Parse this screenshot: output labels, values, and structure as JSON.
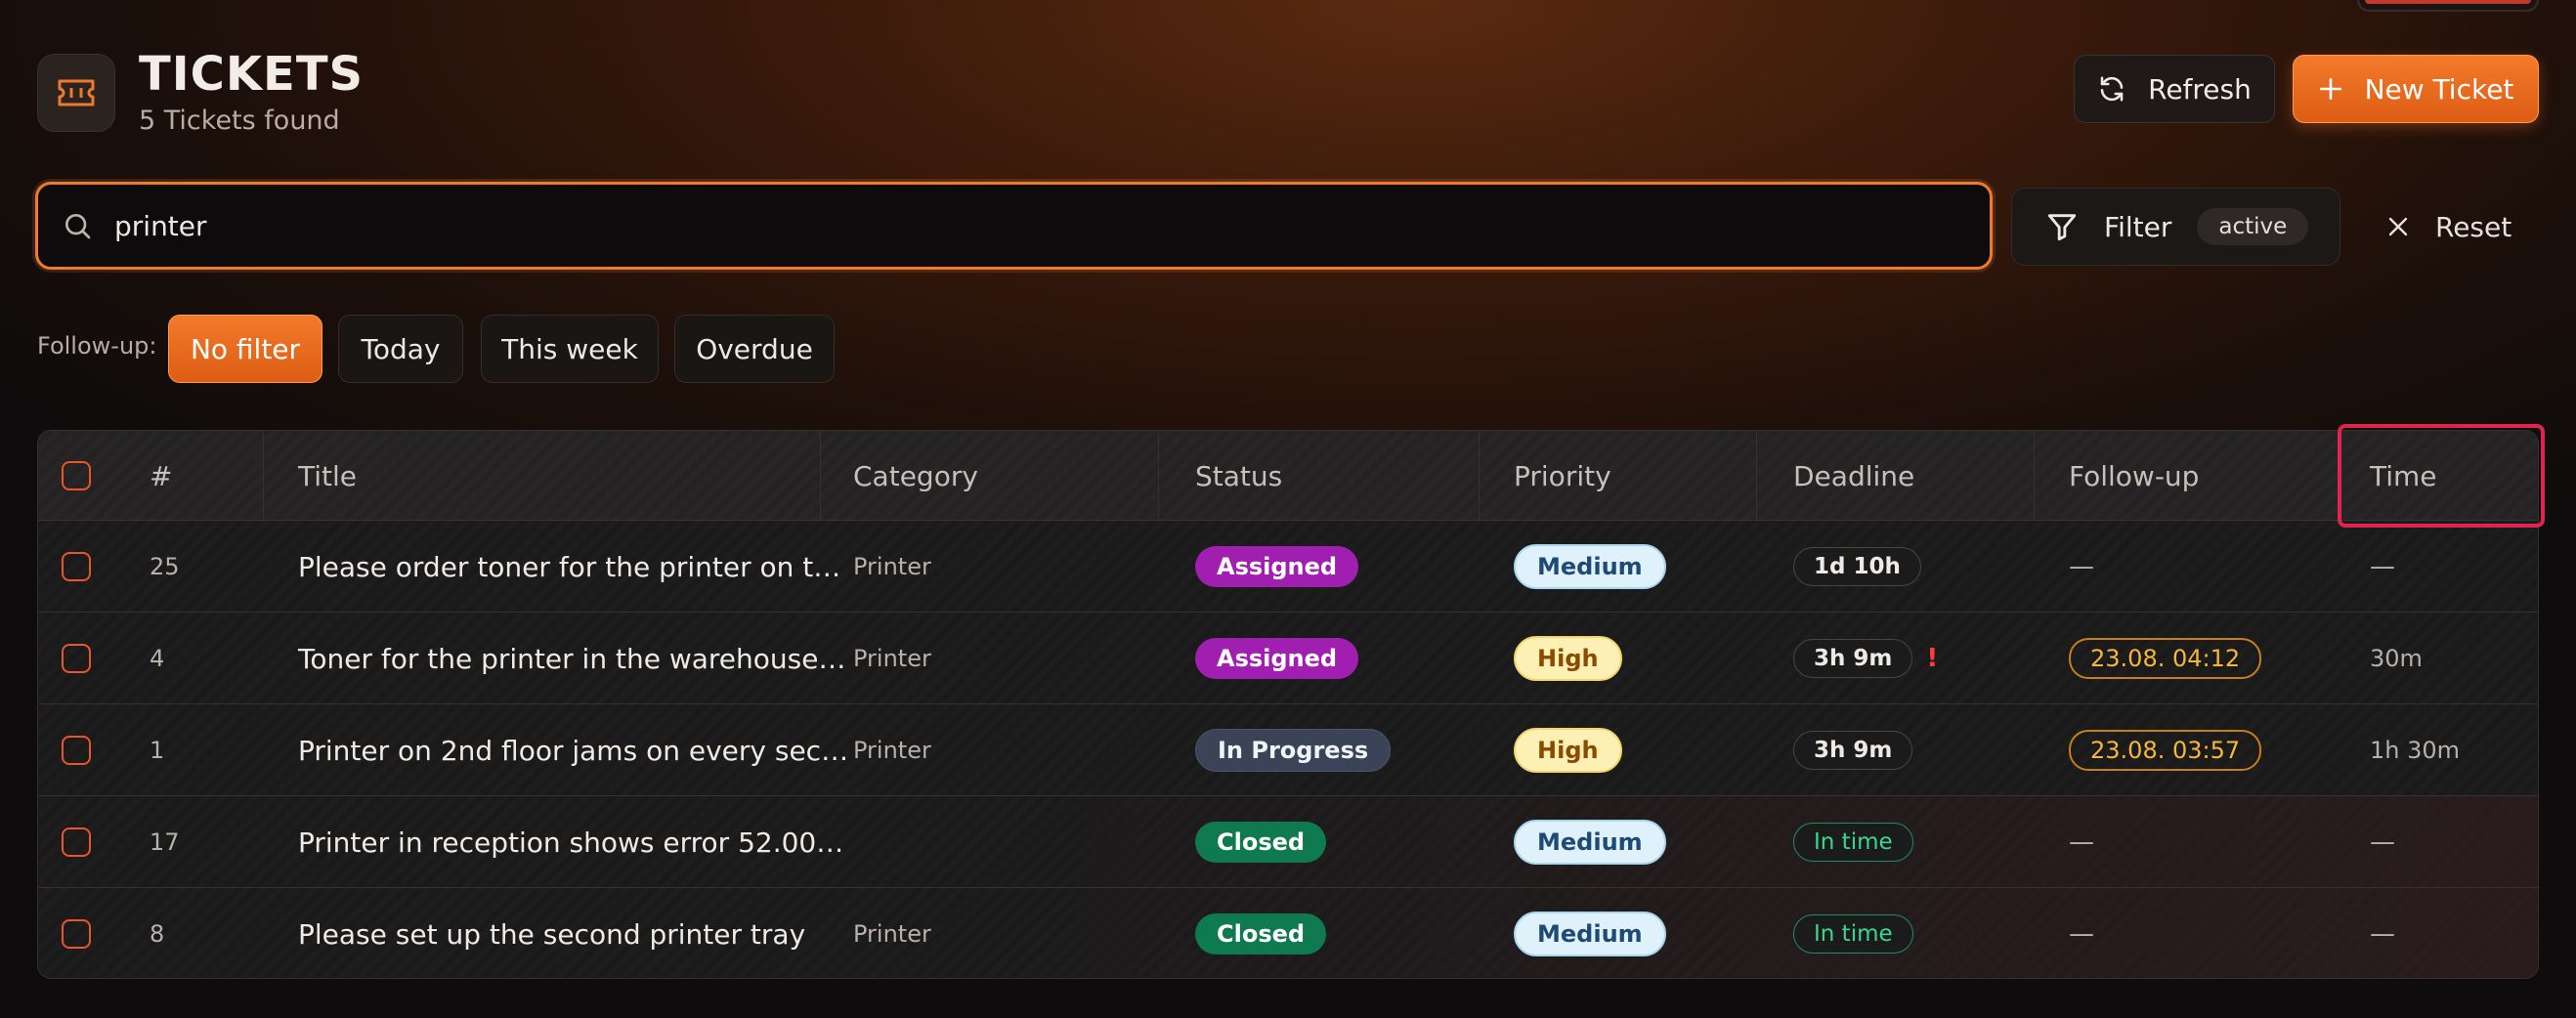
{
  "header": {
    "title": "TICKETS",
    "subtitle": "5 Tickets found",
    "refresh_label": "Refresh",
    "new_ticket_label": "New Ticket"
  },
  "search": {
    "value": "printer",
    "placeholder": ""
  },
  "filter": {
    "label": "Filter",
    "badge": "active",
    "reset_label": "Reset"
  },
  "followup_filter": {
    "label": "Follow-up:",
    "chips": [
      "No filter",
      "Today",
      "This week",
      "Overdue"
    ],
    "active": "No filter"
  },
  "table": {
    "columns": [
      "#",
      "Title",
      "Category",
      "Status",
      "Priority",
      "Deadline",
      "Follow-up",
      "Time"
    ],
    "rows": [
      {
        "id": "25",
        "title": "Please order toner for the printer on t…",
        "category": "Printer",
        "status": "Assigned",
        "priority": "Medium",
        "deadline": "1d 10h",
        "deadline_warn": "",
        "followup": "—",
        "time": "—"
      },
      {
        "id": "4",
        "title": "Toner for the printer in the warehouse…",
        "category": "Printer",
        "status": "Assigned",
        "priority": "High",
        "deadline": "3h 9m",
        "deadline_warn": "!",
        "followup": "23.08. 04:12",
        "time": "30m"
      },
      {
        "id": "1",
        "title": "Printer on 2nd floor jams on every sec…",
        "category": "Printer",
        "status": "In Progress",
        "priority": "High",
        "deadline": "3h 9m",
        "deadline_warn": "",
        "followup": "23.08. 03:57",
        "time": "1h 30m"
      },
      {
        "id": "17",
        "title": "Printer in reception shows error 52.00…",
        "category": "",
        "status": "Closed",
        "priority": "Medium",
        "deadline": "In time",
        "deadline_warn": "",
        "followup": "—",
        "time": "—"
      },
      {
        "id": "8",
        "title": "Please set up the second printer tray",
        "category": "Printer",
        "status": "Closed",
        "priority": "Medium",
        "deadline": "In time",
        "deadline_warn": "",
        "followup": "—",
        "time": "—"
      }
    ]
  },
  "colors": {
    "accent": "#f07a2c",
    "highlight": "#e0234f",
    "assigned": "#a01fb0",
    "closed": "#0f7a4f"
  }
}
